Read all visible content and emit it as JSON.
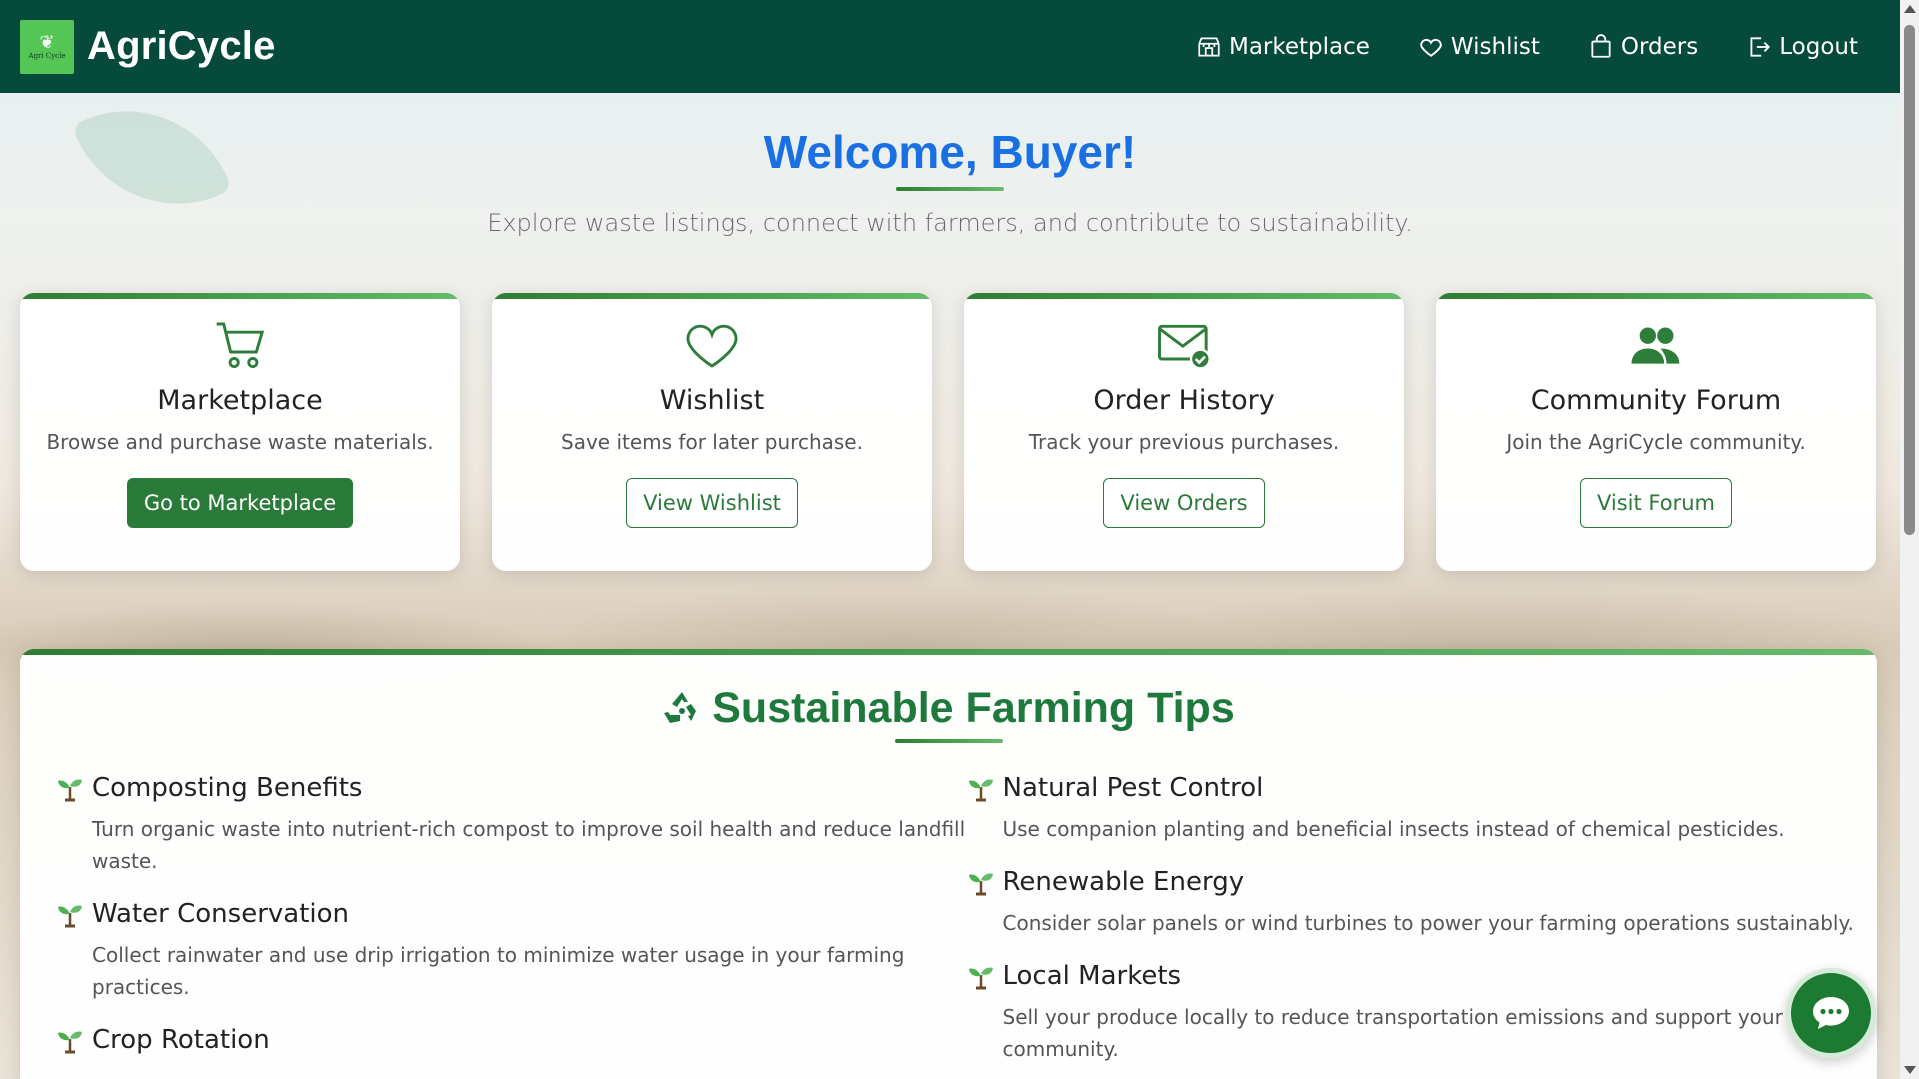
{
  "brand": {
    "name": "AgriCycle",
    "logo_text": "Agri Cycle"
  },
  "nav": [
    {
      "label": "Marketplace",
      "icon": "shop-icon"
    },
    {
      "label": "Wishlist",
      "icon": "heart-icon"
    },
    {
      "label": "Orders",
      "icon": "bag-icon"
    },
    {
      "label": "Logout",
      "icon": "logout-icon"
    }
  ],
  "welcome": {
    "title": "Welcome, Buyer!",
    "subtitle": "Explore waste listings, connect with farmers, and contribute to sustainability."
  },
  "cards": [
    {
      "title": "Marketplace",
      "desc": "Browse and purchase waste materials.",
      "button": "Go to Marketplace",
      "icon": "cart-icon"
    },
    {
      "title": "Wishlist",
      "desc": "Save items for later purchase.",
      "button": "View Wishlist",
      "icon": "heart-icon"
    },
    {
      "title": "Order History",
      "desc": "Track your previous purchases.",
      "button": "View Orders",
      "icon": "envelope-check-icon"
    },
    {
      "title": "Community Forum",
      "desc": "Join the AgriCycle community.",
      "button": "Visit Forum",
      "icon": "people-icon"
    }
  ],
  "tips": {
    "title": "Sustainable Farming Tips",
    "left": [
      {
        "title": "Composting Benefits",
        "text": "Turn organic waste into nutrient-rich compost to improve soil health and reduce landfill waste."
      },
      {
        "title": "Water Conservation",
        "text": "Collect rainwater and use drip irrigation to minimize water usage in your farming practices."
      },
      {
        "title": "Crop Rotation",
        "text": ""
      }
    ],
    "right": [
      {
        "title": "Natural Pest Control",
        "text": "Use companion planting and beneficial insects instead of chemical pesticides."
      },
      {
        "title": "Renewable Energy",
        "text": "Consider solar panels or wind turbines to power your farming operations sustainably."
      },
      {
        "title": "Local Markets",
        "text": "Sell your produce locally to reduce transportation emissions and support your community."
      }
    ]
  },
  "colors": {
    "header": "#054a3b",
    "accent_green": "#2a7a3a",
    "welcome_blue": "#1a6fe3",
    "tips_title": "#1e7a3c"
  }
}
